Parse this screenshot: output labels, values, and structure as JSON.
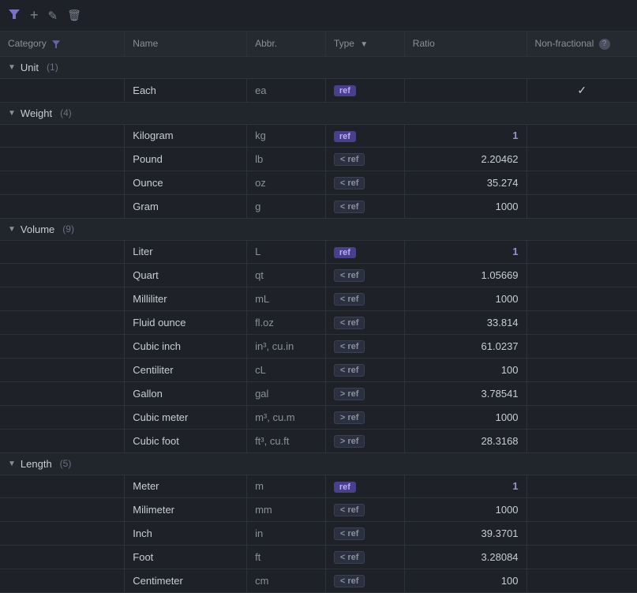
{
  "toolbar": {
    "icons": [
      {
        "name": "filter-icon",
        "symbol": "▼",
        "label": "Filter"
      },
      {
        "name": "add-icon",
        "symbol": "+",
        "label": "Add"
      },
      {
        "name": "edit-icon",
        "symbol": "✎",
        "label": "Edit"
      },
      {
        "name": "delete-icon",
        "symbol": "🗑",
        "label": "Delete"
      }
    ]
  },
  "columns": {
    "category": "Category",
    "name": "Name",
    "abbr": "Abbr.",
    "type": "Type",
    "ratio": "Ratio",
    "nonfrac": "Non-fractional"
  },
  "groups": [
    {
      "name": "Unit",
      "count": 1,
      "rows": [
        {
          "name": "Each",
          "abbr": "ea",
          "type": "ref",
          "ratio": "",
          "nonfrac": true
        }
      ]
    },
    {
      "name": "Weight",
      "count": 4,
      "rows": [
        {
          "name": "Kilogram",
          "abbr": "kg",
          "type": "ref",
          "ratio": "1",
          "nonfrac": false,
          "ratioIsRef": true
        },
        {
          "name": "Pound",
          "abbr": "lb",
          "type": "< ref",
          "ratio": "2.20462",
          "nonfrac": false
        },
        {
          "name": "Ounce",
          "abbr": "oz",
          "type": "< ref",
          "ratio": "35.274",
          "nonfrac": false
        },
        {
          "name": "Gram",
          "abbr": "g",
          "type": "< ref",
          "ratio": "1000",
          "nonfrac": false
        }
      ]
    },
    {
      "name": "Volume",
      "count": 9,
      "rows": [
        {
          "name": "Liter",
          "abbr": "L",
          "type": "ref",
          "ratio": "1",
          "nonfrac": false,
          "ratioIsRef": true
        },
        {
          "name": "Quart",
          "abbr": "qt",
          "type": "< ref",
          "ratio": "1.05669",
          "nonfrac": false
        },
        {
          "name": "Milliliter",
          "abbr": "mL",
          "type": "< ref",
          "ratio": "1000",
          "nonfrac": false
        },
        {
          "name": "Fluid ounce",
          "abbr": "fl.oz",
          "type": "< ref",
          "ratio": "33.814",
          "nonfrac": false
        },
        {
          "name": "Cubic inch",
          "abbr": "in³, cu.in",
          "type": "< ref",
          "ratio": "61.0237",
          "nonfrac": false
        },
        {
          "name": "Centiliter",
          "abbr": "cL",
          "type": "< ref",
          "ratio": "100",
          "nonfrac": false
        },
        {
          "name": "Gallon",
          "abbr": "gal",
          "type": "> ref",
          "ratio": "3.78541",
          "nonfrac": false
        },
        {
          "name": "Cubic meter",
          "abbr": "m³, cu.m",
          "type": "> ref",
          "ratio": "1000",
          "nonfrac": false
        },
        {
          "name": "Cubic foot",
          "abbr": "ft³, cu.ft",
          "type": "> ref",
          "ratio": "28.3168",
          "nonfrac": false
        }
      ]
    },
    {
      "name": "Length",
      "count": 5,
      "rows": [
        {
          "name": "Meter",
          "abbr": "m",
          "type": "ref",
          "ratio": "1",
          "nonfrac": false,
          "ratioIsRef": true
        },
        {
          "name": "Milimeter",
          "abbr": "mm",
          "type": "< ref",
          "ratio": "1000",
          "nonfrac": false
        },
        {
          "name": "Inch",
          "abbr": "in",
          "type": "< ref",
          "ratio": "39.3701",
          "nonfrac": false
        },
        {
          "name": "Foot",
          "abbr": "ft",
          "type": "< ref",
          "ratio": "3.28084",
          "nonfrac": false
        },
        {
          "name": "Centimeter",
          "abbr": "cm",
          "type": "< ref",
          "ratio": "100",
          "nonfrac": false
        }
      ]
    }
  ]
}
